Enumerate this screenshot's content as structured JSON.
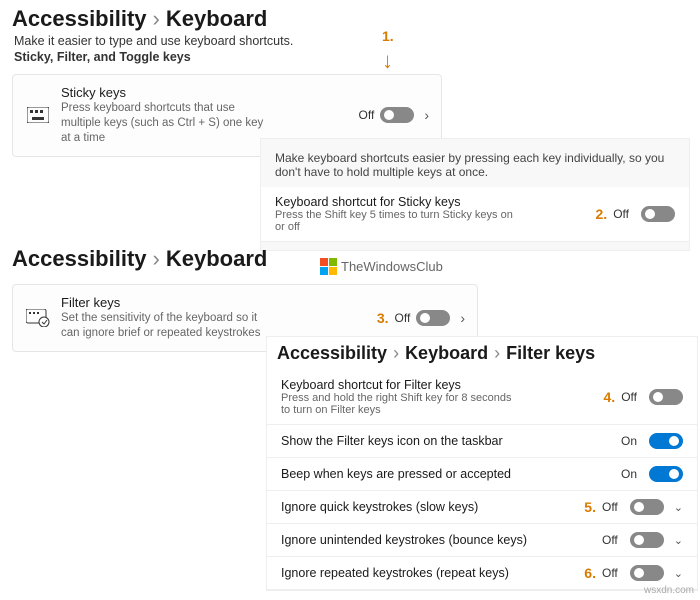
{
  "section1": {
    "bc": [
      "Accessibility",
      "Keyboard"
    ],
    "sub1": "Make it easier to type and use keyboard shortcuts.",
    "sub2": "Sticky, Filter, and Toggle keys",
    "card": {
      "title": "Sticky keys",
      "desc": "Press keyboard shortcuts that use multiple keys (such as Ctrl + S) one key at a time",
      "state": "Off"
    },
    "annot": "1."
  },
  "section2": {
    "intro": "Make keyboard shortcuts easier by pressing each key individually, so you don't have to hold multiple keys at once.",
    "row": {
      "title": "Keyboard shortcut for Sticky keys",
      "desc": "Press the Shift key 5 times to turn Sticky keys on or off",
      "state": "Off"
    },
    "annot": "2."
  },
  "section3": {
    "bc": [
      "Accessibility",
      "Keyboard"
    ],
    "card": {
      "title": "Filter keys",
      "desc": "Set the sensitivity of the keyboard so it can ignore brief or repeated keystrokes",
      "state": "Off"
    },
    "annot": "3.",
    "logo": "TheWindowsClub"
  },
  "section4": {
    "bc": [
      "Accessibility",
      "Keyboard",
      "Filter keys"
    ],
    "rows": [
      {
        "title": "Keyboard shortcut for Filter keys",
        "desc": "Press and hold the right Shift key for 8 seconds to turn on Filter keys",
        "state": "Off",
        "annot": "4."
      },
      {
        "title": "Show the Filter keys icon on the taskbar",
        "desc": "",
        "state": "On"
      },
      {
        "title": "Beep when keys are pressed or accepted",
        "desc": "",
        "state": "On"
      },
      {
        "title": "Ignore quick keystrokes (slow keys)",
        "desc": "",
        "state": "Off",
        "annot": "5.",
        "caret": true
      },
      {
        "title": "Ignore unintended keystrokes (bounce keys)",
        "desc": "",
        "state": "Off",
        "caret": true
      },
      {
        "title": "Ignore repeated keystrokes (repeat keys)",
        "desc": "",
        "state": "Off",
        "annot": "6.",
        "caret": true
      }
    ]
  },
  "watermark": "wsxdn.com"
}
